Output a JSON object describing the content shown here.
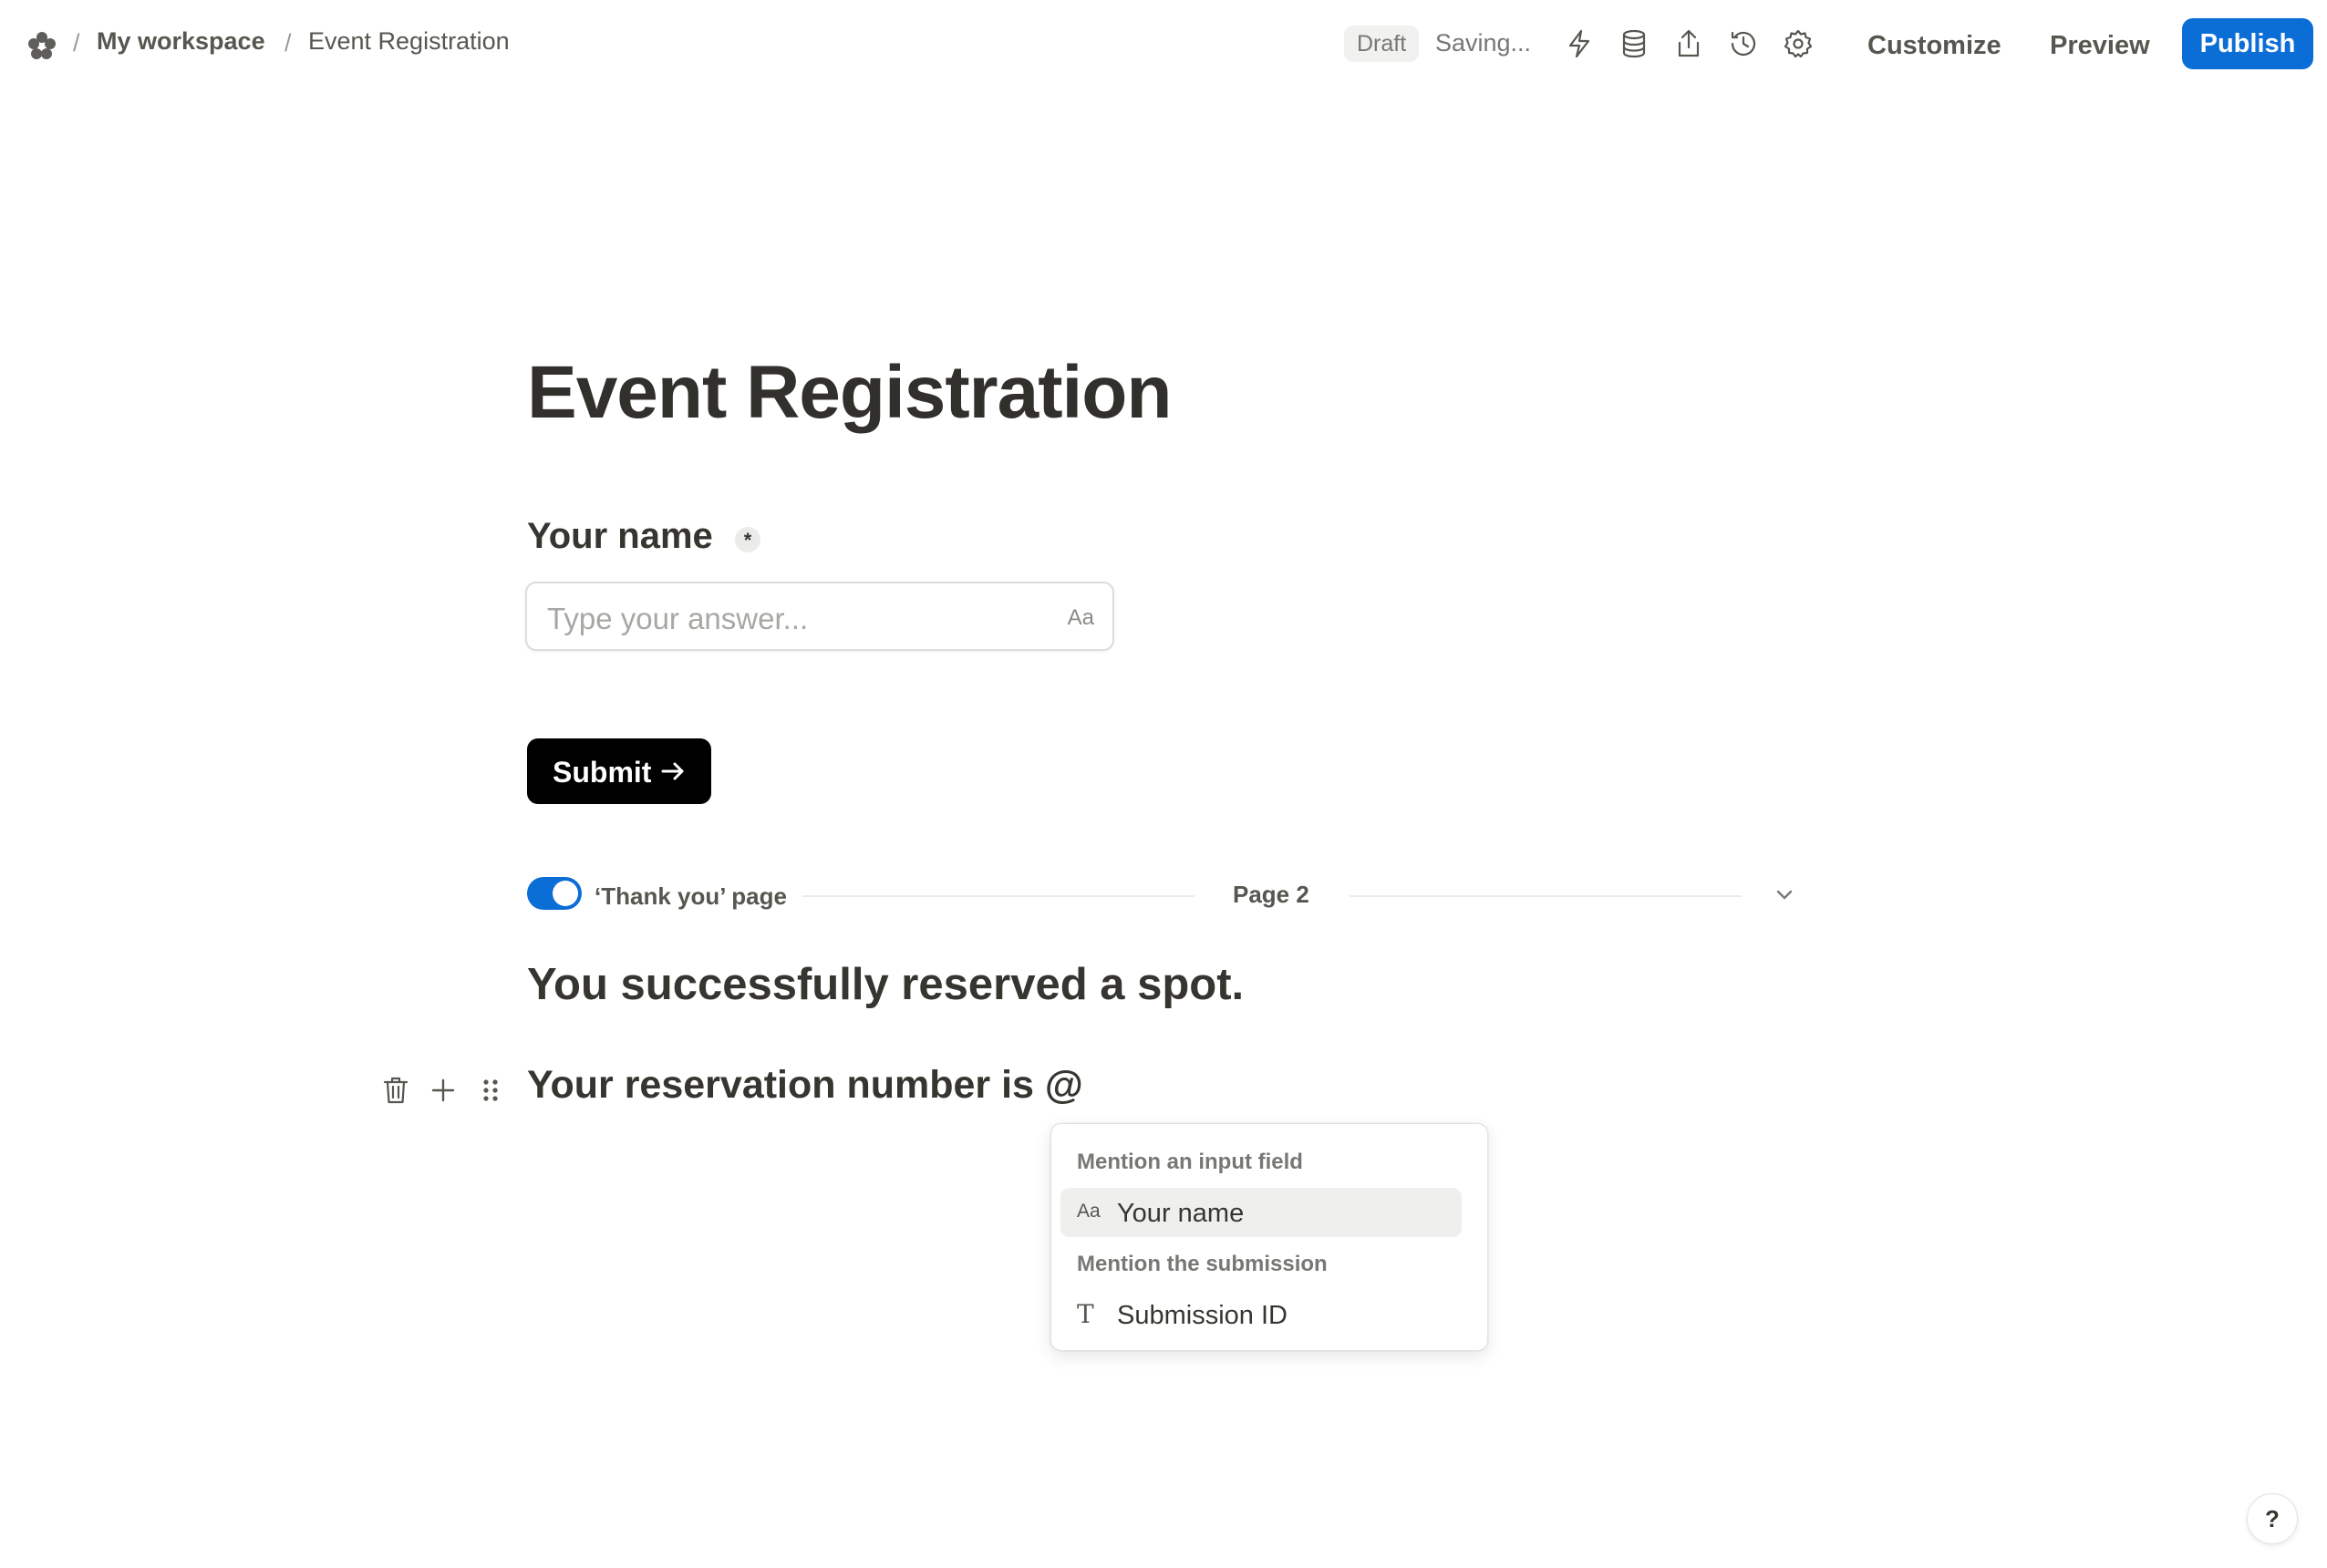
{
  "header": {
    "logo_icon": "flower-logo-icon",
    "breadcrumbs": [
      "My workspace",
      "Event Registration"
    ],
    "separator": "/",
    "status_badge": "Draft",
    "status_text": "Saving...",
    "icons": [
      "lightning-icon",
      "database-icon",
      "share-icon",
      "history-icon",
      "gear-icon"
    ],
    "customize_label": "Customize",
    "preview_label": "Preview",
    "publish_label": "Publish",
    "accent_color": "#0b6dd6"
  },
  "form": {
    "title": "Event Registration",
    "field": {
      "label": "Your name",
      "required_mark": "*",
      "placeholder": "Type your answer...",
      "type_icon_text": "Aa"
    },
    "submit_label": "Submit"
  },
  "thank_you": {
    "toggle_label": "‘Thank you’ page",
    "toggle_on": true,
    "page_label": "Page 2",
    "heading": "You successfully reserved a spot.",
    "line": "Your reservation number is @"
  },
  "mention_menu": {
    "section_inputs": "Mention an input field",
    "input_items": [
      {
        "icon_text": "Aa",
        "label": "Your name"
      }
    ],
    "section_submission": "Mention the submission",
    "submission_items": [
      {
        "icon_text": "T",
        "label": "Submission ID"
      }
    ]
  },
  "help_label": "?"
}
